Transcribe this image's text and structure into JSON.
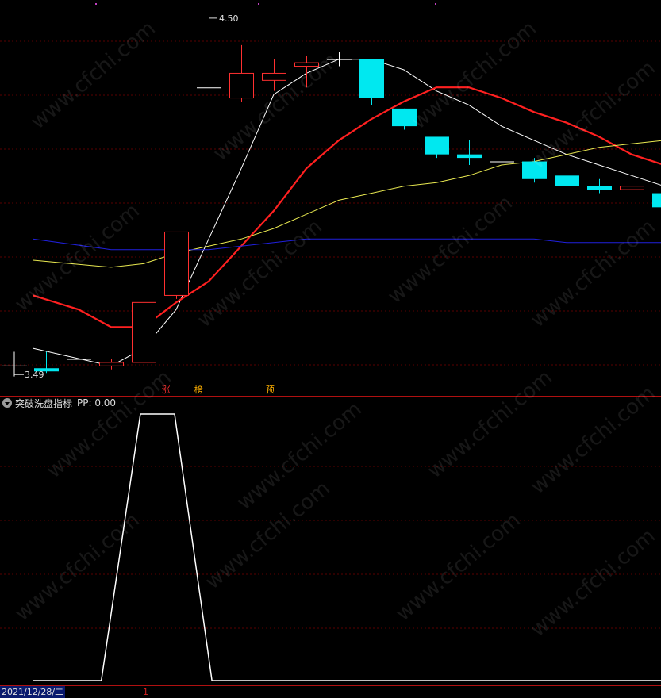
{
  "chart_data": [
    {
      "type": "candlestick",
      "price_high_label": "4.50",
      "price_low_label": "3.49",
      "ylim": [
        3.44,
        4.52
      ],
      "x_count": 21,
      "candles": [
        {
          "open": 3.49,
          "close": 3.49,
          "high": 3.54,
          "low": 3.48
        },
        {
          "open": 3.52,
          "close": 3.52,
          "high": 3.54,
          "low": 3.5
        },
        {
          "open": 3.5,
          "close": 3.51,
          "high": 3.52,
          "low": 3.49
        },
        {
          "open": 3.51,
          "close": 3.68,
          "high": 3.68,
          "low": 3.51
        },
        {
          "open": 3.7,
          "close": 3.88,
          "high": 3.88,
          "low": 3.69
        },
        {
          "open": 4.29,
          "close": 4.29,
          "high": 4.5,
          "low": 4.24
        },
        {
          "open": 4.26,
          "close": 4.33,
          "high": 4.41,
          "low": 4.25
        },
        {
          "open": 4.31,
          "close": 4.33,
          "high": 4.37,
          "low": 4.28
        },
        {
          "open": 4.35,
          "close": 4.36,
          "high": 4.38,
          "low": 4.29
        },
        {
          "open": 4.37,
          "close": 4.37,
          "high": 4.39,
          "low": 4.35
        },
        {
          "open": 4.37,
          "close": 4.26,
          "high": 4.37,
          "low": 4.24
        },
        {
          "open": 4.23,
          "close": 4.18,
          "high": 4.23,
          "low": 4.17
        },
        {
          "open": 4.15,
          "close": 4.1,
          "high": 4.15,
          "low": 4.09
        },
        {
          "open": 4.1,
          "close": 4.09,
          "high": 4.14,
          "low": 4.07
        },
        {
          "open": 4.08,
          "close": 4.08,
          "high": 4.1,
          "low": 4.07
        },
        {
          "open": 4.08,
          "close": 4.03,
          "high": 4.09,
          "low": 4.02
        },
        {
          "open": 4.04,
          "close": 4.01,
          "high": 4.06,
          "low": 4.0
        },
        {
          "open": 4.01,
          "close": 4.0,
          "high": 4.03,
          "low": 3.99
        },
        {
          "open": 4.0,
          "close": 4.01,
          "high": 4.06,
          "low": 3.96
        },
        {
          "open": 3.99,
          "close": 3.95,
          "high": 4.0,
          "low": 3.93
        },
        {
          "open": 3.96,
          "close": 3.96,
          "high": 3.96,
          "low": 3.96
        }
      ],
      "ma_lines": [
        {
          "color": "#ffffff",
          "width": 1,
          "points": [
            [
              -0.4,
              3.55
            ],
            [
              2,
              3.5
            ],
            [
              3,
              3.55
            ],
            [
              4,
              3.66
            ],
            [
              5,
              3.86
            ],
            [
              6,
              4.06
            ],
            [
              7,
              4.27
            ],
            [
              8,
              4.33
            ],
            [
              9,
              4.37
            ],
            [
              10,
              4.37
            ],
            [
              11,
              4.34
            ],
            [
              12,
              4.28
            ],
            [
              13,
              4.24
            ],
            [
              14,
              4.18
            ],
            [
              15,
              4.14
            ],
            [
              16,
              4.1
            ],
            [
              17,
              4.07
            ],
            [
              18,
              4.04
            ],
            [
              19,
              4.01
            ],
            [
              19.6,
              3.98
            ],
            [
              20.4,
              3.96
            ]
          ]
        },
        {
          "color": "#ff2020",
          "width": 2.2,
          "points": [
            [
              -0.4,
              3.7
            ],
            [
              1,
              3.66
            ],
            [
              2,
              3.61
            ],
            [
              3,
              3.61
            ],
            [
              4,
              3.68
            ],
            [
              5,
              3.74
            ],
            [
              6,
              3.84
            ],
            [
              7,
              3.94
            ],
            [
              8,
              4.06
            ],
            [
              9,
              4.14
            ],
            [
              10,
              4.2
            ],
            [
              11,
              4.25
            ],
            [
              12,
              4.29
            ],
            [
              13,
              4.29
            ],
            [
              14,
              4.26
            ],
            [
              15,
              4.22
            ],
            [
              16,
              4.19
            ],
            [
              17,
              4.15
            ],
            [
              18,
              4.1
            ],
            [
              19,
              4.07
            ],
            [
              20,
              4.03
            ],
            [
              20.4,
              4.01
            ]
          ]
        },
        {
          "color": "#e8e850",
          "width": 1,
          "points": [
            [
              -0.4,
              3.8
            ],
            [
              2,
              3.78
            ],
            [
              3,
              3.79
            ],
            [
              4,
              3.82
            ],
            [
              5,
              3.84
            ],
            [
              6,
              3.86
            ],
            [
              7,
              3.89
            ],
            [
              8,
              3.93
            ],
            [
              9,
              3.97
            ],
            [
              10,
              3.99
            ],
            [
              11,
              4.01
            ],
            [
              12,
              4.02
            ],
            [
              13,
              4.04
            ],
            [
              14,
              4.07
            ],
            [
              15,
              4.08
            ],
            [
              16,
              4.1
            ],
            [
              17,
              4.12
            ],
            [
              18,
              4.13
            ],
            [
              19,
              4.14
            ],
            [
              20,
              4.15
            ],
            [
              20.4,
              4.16
            ]
          ]
        },
        {
          "color": "#2020dd",
          "width": 1,
          "points": [
            [
              -0.4,
              3.86
            ],
            [
              2,
              3.83
            ],
            [
              3,
              3.83
            ],
            [
              4,
              3.83
            ],
            [
              5,
              3.83
            ],
            [
              6,
              3.84
            ],
            [
              7,
              3.85
            ],
            [
              8,
              3.86
            ],
            [
              9,
              3.86
            ],
            [
              10,
              3.86
            ],
            [
              11,
              3.86
            ],
            [
              12,
              3.86
            ],
            [
              13,
              3.86
            ],
            [
              14,
              3.86
            ],
            [
              15,
              3.86
            ],
            [
              16,
              3.85
            ],
            [
              17,
              3.85
            ],
            [
              18,
              3.85
            ],
            [
              19,
              3.85
            ],
            [
              20,
              3.85
            ],
            [
              20.4,
              3.85
            ]
          ]
        }
      ]
    },
    {
      "type": "line",
      "indicator_name": "突破洗盘指标",
      "series_label": "PP: 0.00",
      "ylim": [
        0,
        1
      ],
      "x": [
        -0.4,
        1.7,
        2.9,
        3.95,
        5.1,
        20.4
      ],
      "values": [
        0,
        0,
        1,
        1,
        0,
        0
      ]
    }
  ],
  "badges": [
    {
      "text": "涨",
      "color": "#ff3030",
      "x_index": 3.7
    },
    {
      "text": "榜",
      "color": "#ffb000",
      "x_index": 4.7
    },
    {
      "text": "预",
      "color": "#ffb000",
      "x_index": 6.9
    }
  ],
  "date_label": "2021/12/28/二",
  "cursor_tick": "1",
  "watermark": "www.cfchi.com"
}
